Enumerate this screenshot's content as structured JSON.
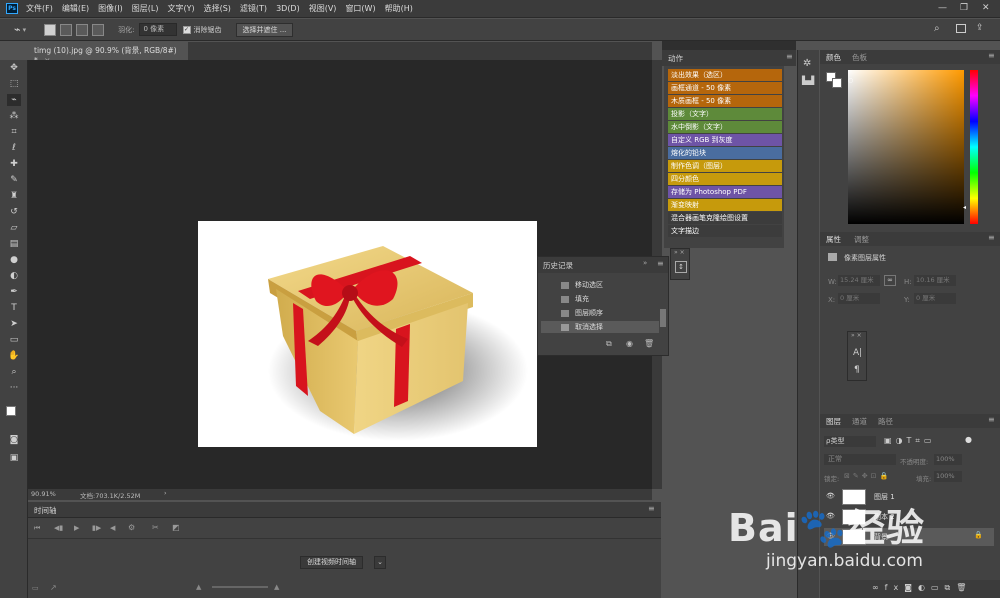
{
  "menubar": {
    "items": [
      "文件(F)",
      "编辑(E)",
      "图像(I)",
      "图层(L)",
      "文字(Y)",
      "选择(S)",
      "滤镜(T)",
      "3D(D)",
      "视图(V)",
      "窗口(W)",
      "帮助(H)"
    ],
    "logo": "Ps"
  },
  "options": {
    "feather_label": "羽化:",
    "feather_value": "0 像素",
    "antialias_label": "消除锯齿",
    "select_mask_label": "选择并遮住 ..."
  },
  "document": {
    "tab_title": "timg (10).jpg @ 90.9% (背景, RGB/8#) *",
    "zoom": "90.91%",
    "doc_size": "文档:703.1K/2.52M"
  },
  "timeline": {
    "title": "时间轴",
    "create_button": "创建视频时间轴"
  },
  "actions": {
    "title": "动作",
    "items": [
      {
        "label": "淡出效果（选区）",
        "color": "#b5660c"
      },
      {
        "label": "画框通道 - 50 像素",
        "color": "#b5660c"
      },
      {
        "label": "木质画框 - 50 像素",
        "color": "#b5660c"
      },
      {
        "label": "投影（文字）",
        "color": "#5e8a3a"
      },
      {
        "label": "水中倒影（文字）",
        "color": "#5e8a3a"
      },
      {
        "label": "自定义 RGB 到灰度",
        "color": "#6e54a6"
      },
      {
        "label": "熔化的铅块",
        "color": "#4a6da0"
      },
      {
        "label": "制作色调（图层）",
        "color": "#c69a0c"
      },
      {
        "label": "四分颜色",
        "color": "#c69a0c"
      },
      {
        "label": "存储为 Photoshop PDF",
        "color": "#6e54a6"
      },
      {
        "label": "渐变映射",
        "color": "#c69a0c"
      },
      {
        "label": "混合器画笔克隆绘图设置",
        "color": "#3c3c3c"
      },
      {
        "label": "文字描边",
        "color": "#3c3c3c"
      }
    ]
  },
  "history": {
    "title": "历史记录",
    "items": [
      "移动选区",
      "填充",
      "图层顺序",
      "取消选择"
    ]
  },
  "color_panel": {
    "tabs": [
      "颜色",
      "色板"
    ]
  },
  "properties": {
    "tabs": [
      "属性",
      "调整"
    ],
    "subtitle": "像素图层属性",
    "w_label": "W:",
    "w_value": "15.24 厘米",
    "h_label": "H:",
    "h_value": "10.16 厘米",
    "x_label": "X:",
    "x_value": "0 厘米",
    "y_label": "Y:",
    "y_value": "0 厘米"
  },
  "layers": {
    "tabs": [
      "图层",
      "通道",
      "路径"
    ],
    "filter_label": "ρ类型",
    "blend_mode": "正常",
    "opacity_label": "不透明度:",
    "opacity_value": "100%",
    "lock_label": "锁定:",
    "fill_label": "填充:",
    "fill_value": "100%",
    "rows": [
      {
        "name": "图层 1"
      },
      {
        "name": "副本 2"
      },
      {
        "name": "背景"
      }
    ]
  },
  "watermark": {
    "brand": "Bai",
    "brand2": "经验",
    "url": "jingyan.baidu.com"
  }
}
